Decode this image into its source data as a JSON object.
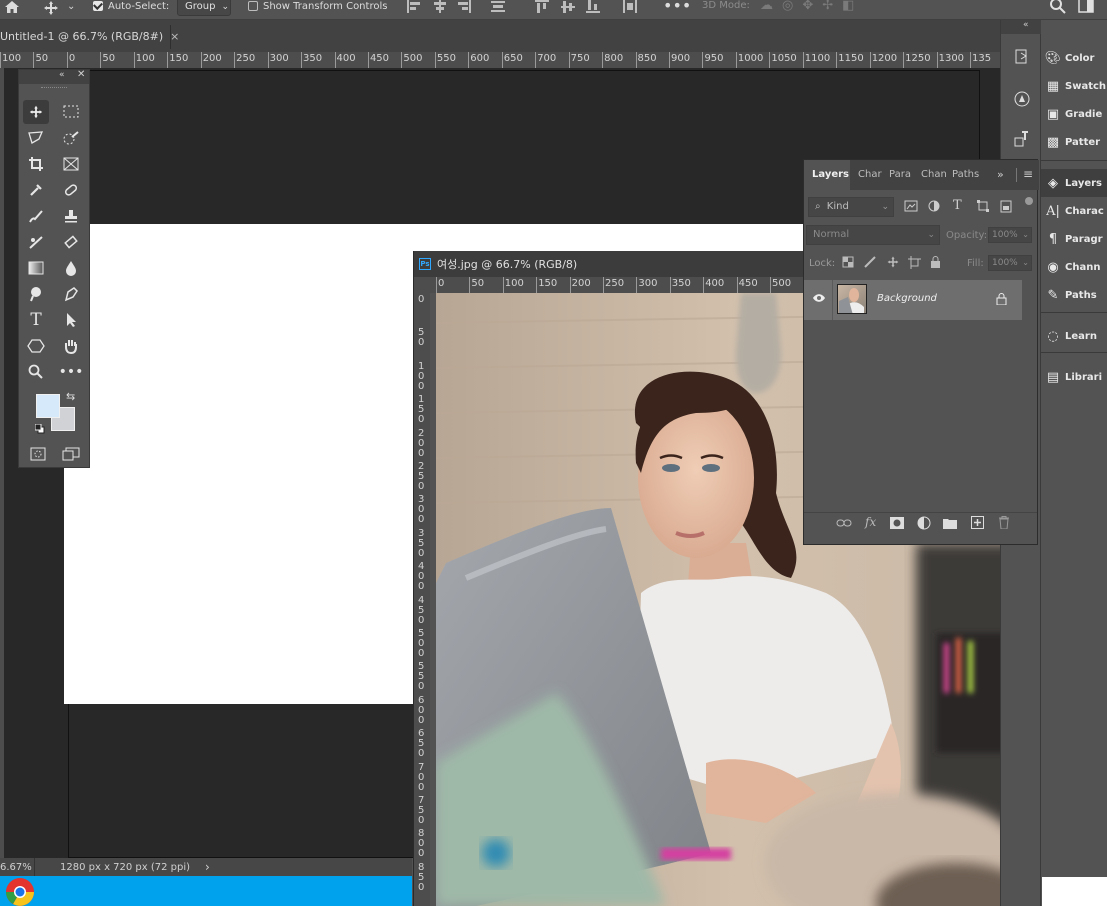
{
  "options_bar": {
    "auto_select_label": "Auto-Select:",
    "group_value": "Group",
    "transform_label": "Show Transform Controls",
    "mode_3d_label": "3D Mode:",
    "more_icon": "ellipsis-icon"
  },
  "document_tab": {
    "title": "Untitled-1 @ 66.7% (RGB/8#)",
    "close": "×"
  },
  "ruler_top_labels": [
    "100",
    "50",
    "0",
    "50",
    "100",
    "150",
    "200",
    "250",
    "300",
    "350",
    "400",
    "450",
    "500",
    "550",
    "600",
    "650",
    "700",
    "750",
    "800",
    "850",
    "900",
    "950",
    "1000",
    "1050",
    "1100",
    "1150",
    "1200",
    "1250",
    "1300",
    "135"
  ],
  "status_bar": {
    "zoom": "6.67%",
    "doc_size": "1280 px x 720 px (72 ppi)",
    "arrow": "›"
  },
  "photo_window": {
    "badge": "Ps",
    "title": "여성.jpg @ 66.7% (RGB/8)",
    "ruler_labels": [
      "0",
      "50",
      "100",
      "150",
      "200",
      "250",
      "300",
      "350",
      "400",
      "450",
      "500"
    ],
    "vruler_labels": [
      "0",
      "5\n0",
      "1\n0\n0",
      "1\n5\n0",
      "2\n0\n0",
      "2\n5\n0",
      "3\n0\n0",
      "3\n5\n0",
      "4\n0\n0",
      "4\n5\n0",
      "5\n0\n0",
      "5\n5\n0",
      "6\n0\n0",
      "6\n5\n0",
      "7\n0\n0",
      "7\n5\n0",
      "8\n0\n0",
      "8\n5\n0"
    ]
  },
  "layers_panel": {
    "tabs": [
      "Layers",
      "Char",
      "Para",
      "Chan",
      "Paths"
    ],
    "kind_label": "Kind",
    "blend_mode": "Normal",
    "opacity_label": "Opacity:",
    "opacity_value": "100%",
    "lock_label": "Lock:",
    "fill_label": "Fill:",
    "fill_value": "100%",
    "layer_name": "Background",
    "footer_fx": "fx"
  },
  "right_dock": {
    "items": [
      "Color",
      "Swatch",
      "Gradie",
      "Patter",
      "Layers",
      "Charac",
      "Paragr",
      "Chann",
      "Paths",
      "Learn",
      "Librari"
    ]
  }
}
